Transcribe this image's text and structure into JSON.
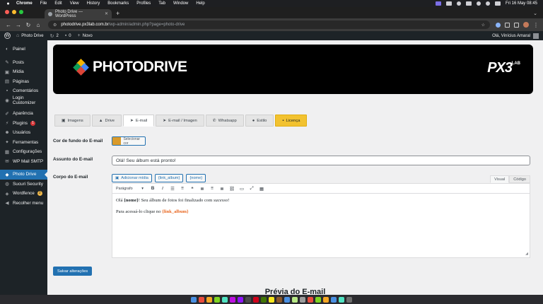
{
  "mac_menubar": {
    "app": "Chrome",
    "menus": [
      "File",
      "Edit",
      "View",
      "History",
      "Bookmarks",
      "Profiles",
      "Tab",
      "Window",
      "Help"
    ],
    "datetime": "Fri 16 May  08:45"
  },
  "browser": {
    "tab_title": "Photo Drive — WordPress",
    "url_host": "photodrive.px3lab.com.br",
    "url_path": "/wp-admin/admin.php?page=photo-drive"
  },
  "admin_bar": {
    "site_name": "Photo Drive",
    "updates_count": "2",
    "comments_count": "0",
    "new_label": "Novo",
    "howdy": "Olá, Vinícius Amaral"
  },
  "sidebar": {
    "items": [
      {
        "label": "Painel",
        "icon": "dashboard-icon"
      },
      {
        "label": "Posts",
        "icon": "pin-icon"
      },
      {
        "label": "Mídia",
        "icon": "media-icon"
      },
      {
        "label": "Páginas",
        "icon": "pages-icon"
      },
      {
        "label": "Comentários",
        "icon": "comments-icon"
      },
      {
        "label": "Login Customizer",
        "icon": "login-icon"
      },
      {
        "label": "Aparência",
        "icon": "brush-icon"
      },
      {
        "label": "Plugins",
        "icon": "plugin-icon",
        "badge": "1"
      },
      {
        "label": "Usuários",
        "icon": "users-icon"
      },
      {
        "label": "Ferramentas",
        "icon": "tools-icon"
      },
      {
        "label": "Configurações",
        "icon": "settings-icon"
      },
      {
        "label": "WP Mail SMTP",
        "icon": "mail-icon"
      },
      {
        "label": "Photo Drive",
        "icon": "photo-drive-icon"
      },
      {
        "label": "Sucuri Security",
        "icon": "shield-icon"
      },
      {
        "label": "Wordfence",
        "icon": "wordfence-icon",
        "badge": "2"
      },
      {
        "label": "Recolher menu",
        "icon": "collapse-icon"
      }
    ]
  },
  "banner": {
    "logo_text": "PHOTODRIVE",
    "partner_logo": "PX3",
    "partner_sub": "LAB"
  },
  "plugin_tabs": [
    {
      "label": "Imagens",
      "icon": "image-icon"
    },
    {
      "label": "Drive",
      "icon": "drive-icon"
    },
    {
      "label": "E-mail",
      "icon": "send-icon"
    },
    {
      "label": "E-mail / Imagen",
      "icon": "send-icon"
    },
    {
      "label": "Whatsapp",
      "icon": "whatsapp-icon"
    },
    {
      "label": "Estilo",
      "icon": "palette-icon"
    },
    {
      "label": "Licença",
      "icon": "lock-icon"
    }
  ],
  "form": {
    "bg_color_label": "Cor de fundo do E-mail",
    "bg_color_value": "#d99a2b",
    "select_color_label": "Selecionar cor",
    "subject_label": "Assunto do E-mail",
    "subject_value": "Olá! Seu álbum está pronto!",
    "body_label": "Corpo do E-mail",
    "add_media_label": "Adicionar mídia",
    "tag_link_album": "{link_album}",
    "tag_nome": "{nome}",
    "visual_tab": "Visual",
    "code_tab": "Código",
    "format_select": "Parágrafo",
    "body_line1_before": "Olá ",
    "body_line1_tag": "{nome}",
    "body_line1_middle": "! Seu álbum de fotos foi finalizado com ",
    "body_line1_em": "sucesso",
    "body_line1_after": "!",
    "body_line2_before": "Para acessá-lo clique no ",
    "body_line2_tag": "{link_album}",
    "save_label": "Salvar alterações"
  },
  "preview_title": "Prévia do E-mail",
  "colors": {
    "wp_dark": "#1d2327",
    "wp_blue": "#2271b1",
    "license_yellow": "#f2c230",
    "tag_orange": "#e8651e"
  }
}
